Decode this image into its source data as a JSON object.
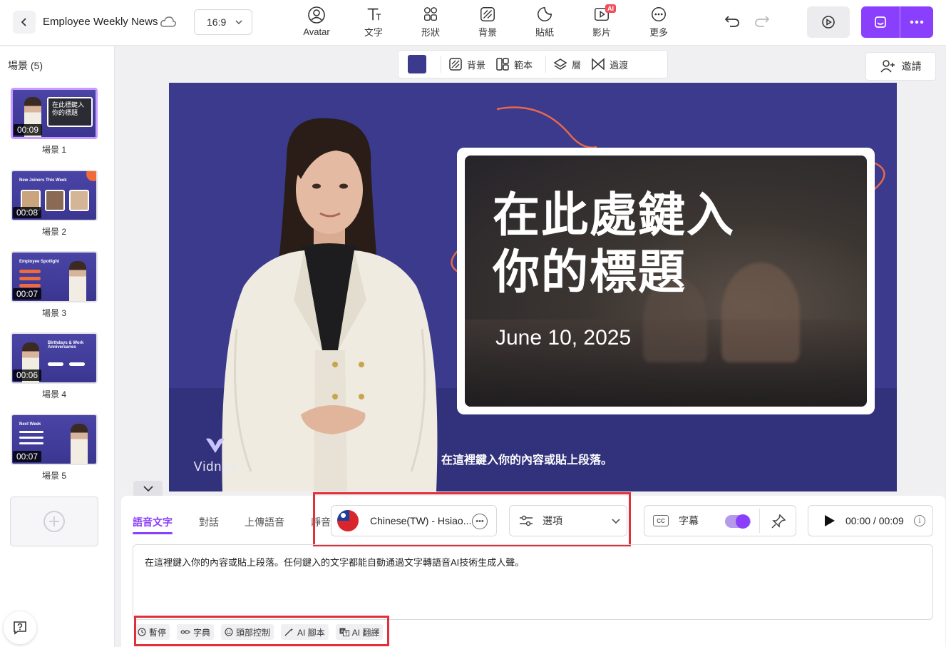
{
  "header": {
    "project_title": "Employee Weekly News",
    "aspect_ratio": "16:9",
    "tools": [
      {
        "label": "Avatar",
        "icon": "avatar-icon"
      },
      {
        "label": "文字",
        "icon": "text-icon"
      },
      {
        "label": "形狀",
        "icon": "shapes-icon"
      },
      {
        "label": "背景",
        "icon": "background-icon"
      },
      {
        "label": "貼紙",
        "icon": "sticker-icon"
      },
      {
        "label": "影片",
        "icon": "video-icon",
        "badge": "AI"
      },
      {
        "label": "更多",
        "icon": "more-icon"
      }
    ],
    "accent_color": "#8a3ffc"
  },
  "scenes": {
    "title": "場景 (5)",
    "items": [
      {
        "name": "場景 1",
        "duration": "00:09",
        "active": true,
        "thumb_title": "在此標鍵入 你的標題"
      },
      {
        "name": "場景 2",
        "duration": "00:08",
        "active": false,
        "thumb_title": "New Joiners This Week"
      },
      {
        "name": "場景 3",
        "duration": "00:07",
        "active": false,
        "thumb_title": "Employee Spotlight"
      },
      {
        "name": "場景 4",
        "duration": "00:06",
        "active": false,
        "thumb_title": "Birthdays & Work Anniversaries"
      },
      {
        "name": "場景 5",
        "duration": "00:07",
        "active": false,
        "thumb_title": "Next Week"
      }
    ]
  },
  "canvas_toolbar": {
    "swatch_color": "#3b3a8c",
    "background_label": "背景",
    "template_label": "範本",
    "layer_label": "層",
    "transition_label": "過渡"
  },
  "invite": {
    "label": "邀請"
  },
  "slide": {
    "headline_line1": "在此處鍵入",
    "headline_line2": "你的標題",
    "date": "June 10, 2025",
    "subtitle": "在這裡鍵入你的內容或貼上段落。",
    "logo_text": "Vidnoz"
  },
  "bottom": {
    "tabs": [
      "語音文字",
      "對話",
      "上傳語音",
      "靜音"
    ],
    "active_tab": "語音文字",
    "voice_name": "Chinese(TW) - Hsiao...",
    "options_label": "選項",
    "caption_label": "字幕",
    "caption_enabled": true,
    "time": "00:00 / 00:09",
    "script_text": "在這裡鍵入你的內容或貼上段落。任何鍵入的文字都能自動通過文字轉語音AI技術生成人聲。",
    "script_tools": [
      {
        "label": "暫停",
        "icon": "clock-icon"
      },
      {
        "label": "字典",
        "icon": "dictionary-icon"
      },
      {
        "label": "頭部控制",
        "icon": "face-icon"
      },
      {
        "label": "AI 腳本",
        "icon": "magic-wand-icon"
      },
      {
        "label": "AI 翻譯",
        "icon": "translate-icon"
      }
    ]
  }
}
